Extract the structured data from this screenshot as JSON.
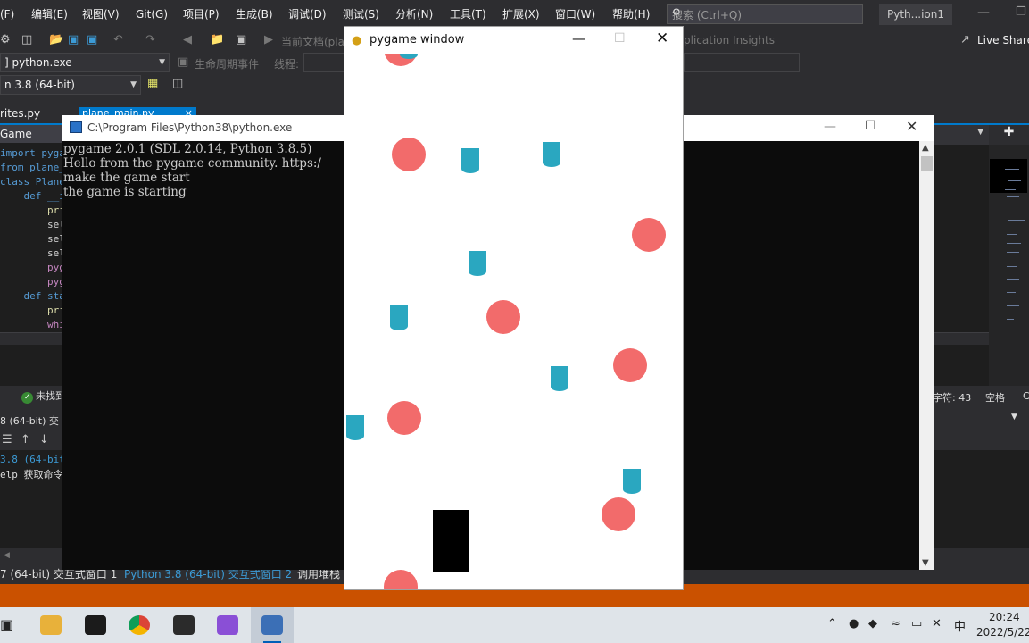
{
  "vs": {
    "menu": [
      "(F)",
      "编辑(E)",
      "视图(V)",
      "Git(G)",
      "项目(P)",
      "生成(B)",
      "调试(D)",
      "测试(S)",
      "分析(N)",
      "工具(T)",
      "扩展(X)",
      "窗口(W)",
      "帮助(H)"
    ],
    "search_placeholder": "搜索 (Ctrl+Q)",
    "solution_name": "Pyth...ion1",
    "toolbar": {
      "current_doc": "当前文档(pla",
      "insights": "plication Insights",
      "live_share": "Live Share",
      "process": "] python.exe",
      "lifecycle": "生命周期事件",
      "thread": "线程:",
      "env": "n 3.8 (64-bit)"
    },
    "tabs": {
      "sprites": "rites.py",
      "main": "plane_main.py"
    },
    "nav": {
      "class": "Game"
    },
    "code_lines": [
      {
        "text": "import pyga",
        "color": "#569cd6"
      },
      {
        "text": "from plane_",
        "color": "#569cd6"
      },
      {
        "text": "class Plane",
        "color": "#569cd6"
      },
      {
        "text": "    def __i",
        "color": "#569cd6"
      },
      {
        "text": "        pri",
        "color": "#dcdcaa"
      },
      {
        "text": "        sel",
        "color": "#d4d4d4"
      },
      {
        "text": "        sel",
        "color": "#d4d4d4"
      },
      {
        "text": "        sel",
        "color": "#d4d4d4"
      },
      {
        "text": "        pyg",
        "color": "#c586c0"
      },
      {
        "text": "        pyg",
        "color": "#c586c0"
      },
      {
        "text": "    def sta",
        "color": "#569cd6"
      },
      {
        "text": "        pri",
        "color": "#dcdcaa"
      },
      {
        "text": "        whi",
        "color": "#c586c0"
      }
    ],
    "status": {
      "ok": "未找到",
      "chars": "字符: 43",
      "space": "空格",
      "c": "C"
    },
    "interactive": {
      "title": "8 (64-bit) 交",
      "line1": "3.8 (64-bit",
      "line2": "elp 获取命令"
    },
    "bottom_tabs": [
      "7 (64-bit) 交互式窗口 1",
      "Python 3.8 (64-bit) 交互式窗口 2",
      "调用堆栈"
    ]
  },
  "console": {
    "title": "C:\\Program Files\\Python38\\python.exe",
    "lines": [
      "pygame 2.0.1 (SDL 2.0.14, Python 3.8.5)",
      "Hello from the pygame community. https:/",
      "make the game start",
      "the game is starting"
    ]
  },
  "pygame": {
    "title": "pygame window",
    "colors": {
      "enemy": "#f26b6b",
      "bullet": "#2aa7c0",
      "player": "#000000"
    }
  },
  "taskbar": {
    "time": "20:24",
    "date": "2022/5/22",
    "ime": "中",
    "apps": [
      "file-explorer-icon",
      "photos-icon",
      "chrome-icon",
      "devtool-icon",
      "visual-studio-icon",
      "python-console-icon"
    ]
  }
}
